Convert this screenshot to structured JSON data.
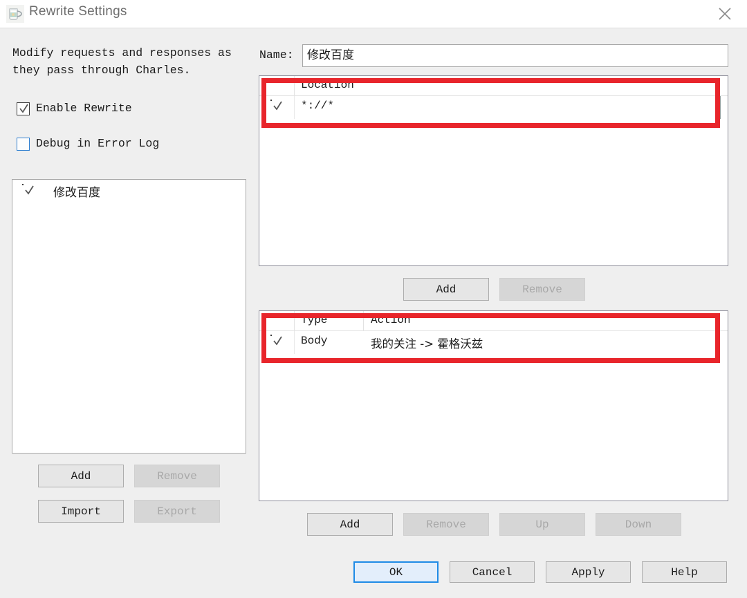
{
  "window": {
    "title": "Rewrite Settings",
    "icon": "charles-jug-icon",
    "close_icon": "close-icon"
  },
  "left": {
    "description": "Modify requests and responses as\nthey pass through Charles.",
    "options": [
      {
        "label": "Enable Rewrite",
        "checked": true
      },
      {
        "label": "Debug in Error Log",
        "checked": false
      }
    ],
    "sets": [
      {
        "label": "修改百度",
        "checked": true
      }
    ],
    "buttons": [
      {
        "label": "Add",
        "enabled": true
      },
      {
        "label": "Remove",
        "enabled": false
      },
      {
        "label": "Import",
        "enabled": true
      },
      {
        "label": "Export",
        "enabled": false
      }
    ]
  },
  "right": {
    "name_label": "Name:",
    "name_value": "修改百度",
    "location_table": {
      "columns": [
        "",
        "Location"
      ],
      "rows": [
        {
          "checked": true,
          "location": "*://*"
        }
      ],
      "buttons": [
        {
          "label": "Add",
          "enabled": true
        },
        {
          "label": "Remove",
          "enabled": false
        }
      ]
    },
    "rules_table": {
      "columns": [
        "",
        "Type",
        "Action"
      ],
      "rows": [
        {
          "checked": true,
          "type": "Body",
          "action": "我的关注 -> 霍格沃兹"
        }
      ],
      "buttons": [
        {
          "label": "Add",
          "enabled": true
        },
        {
          "label": "Remove",
          "enabled": false
        },
        {
          "label": "Up",
          "enabled": false
        },
        {
          "label": "Down",
          "enabled": false
        }
      ]
    }
  },
  "footer": {
    "buttons": [
      {
        "label": "OK",
        "primary": true
      },
      {
        "label": "Cancel",
        "primary": false
      },
      {
        "label": "Apply",
        "primary": false
      },
      {
        "label": "Help",
        "primary": false
      }
    ]
  },
  "annotations": {
    "highlight_color": "#e8252b"
  }
}
